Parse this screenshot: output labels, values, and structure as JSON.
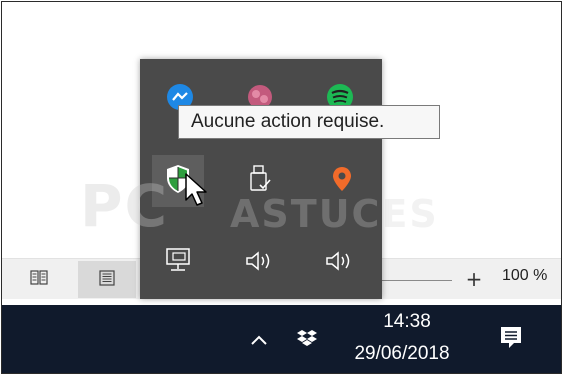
{
  "window": {
    "statusbar": {
      "view_buttons": [
        {
          "icon": "book-view-icon"
        },
        {
          "icon": "page-view-icon"
        }
      ],
      "zoom_plus": "+",
      "zoom_level": "100 %"
    }
  },
  "tray_flyout": {
    "icons": [
      {
        "name": "messenger-icon"
      },
      {
        "name": "app-icon-pink"
      },
      {
        "name": "spotify-icon"
      },
      {
        "name": "windows-defender-icon"
      },
      {
        "name": "usb-eject-icon"
      },
      {
        "name": "app-icon-orange"
      },
      {
        "name": "network-icon"
      },
      {
        "name": "volume-icon"
      },
      {
        "name": "volume-icon-2"
      }
    ],
    "tooltip": "Aucune action requise."
  },
  "watermark": {
    "text": "PC",
    "text2": "ASTUCES"
  },
  "taskbar": {
    "chevron": "^",
    "clock_time": "14:38",
    "clock_date": "29/06/2018"
  },
  "colors": {
    "taskbar": "#101a2c",
    "flyout": "#4a4a4a",
    "spotify": "#1db954",
    "messenger": "#1e88e5",
    "defender_green": "#2e9e3e"
  }
}
